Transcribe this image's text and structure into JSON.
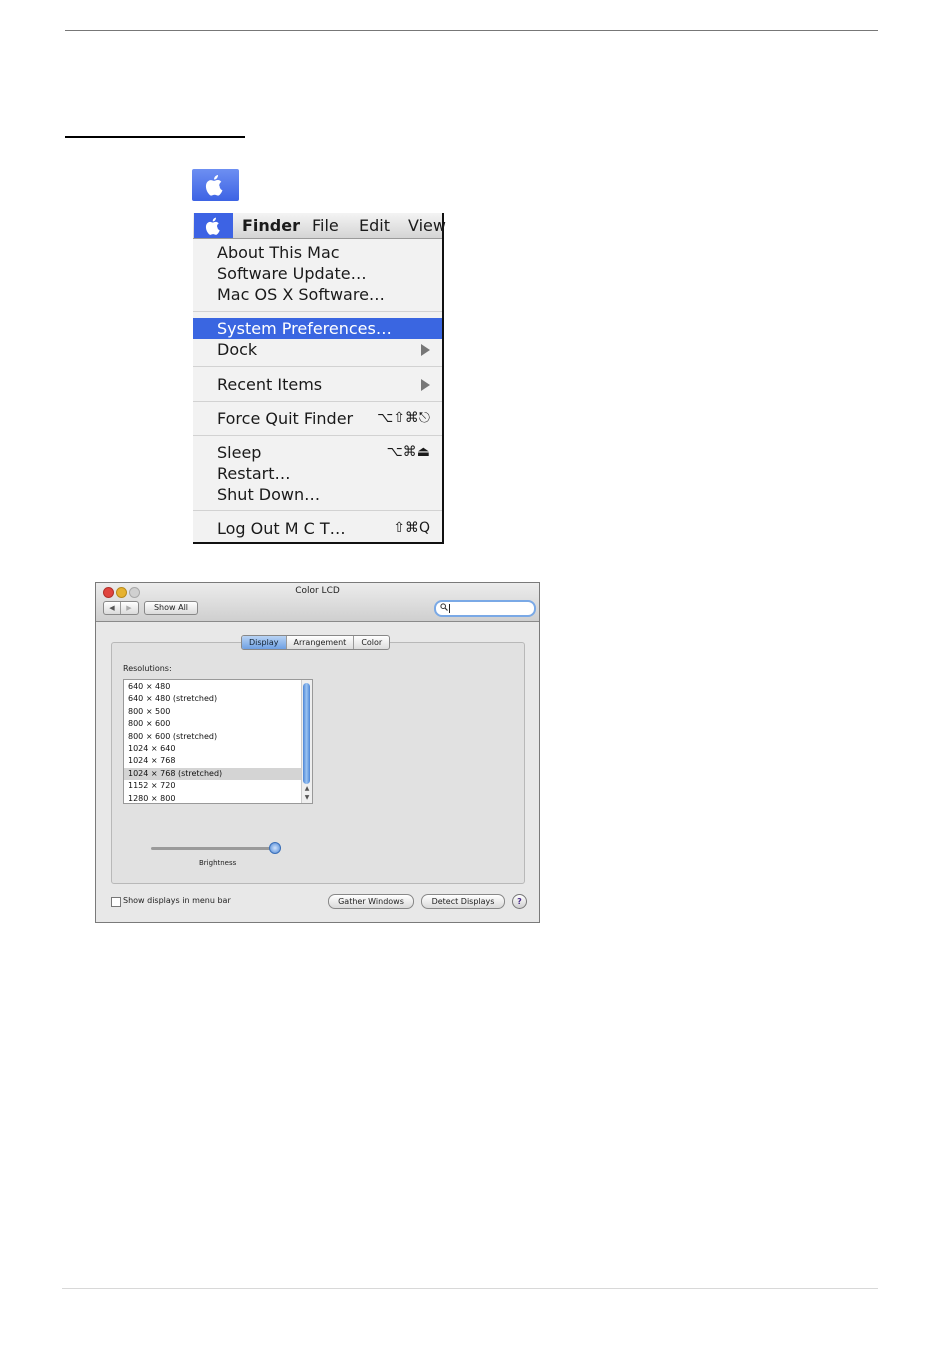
{
  "menu": {
    "menubar": [
      "Finder",
      "File",
      "Edit",
      "View"
    ],
    "items": [
      {
        "label": "About This Mac",
        "shortcut": ""
      },
      {
        "label": "Software Update…",
        "shortcut": ""
      },
      {
        "label": "Mac OS X Software…",
        "shortcut": ""
      },
      {
        "label": "System Preferences…",
        "shortcut": "",
        "highlighted": true
      },
      {
        "label": "Dock",
        "shortcut": "",
        "submenu": true
      },
      {
        "label": "Recent Items",
        "shortcut": "",
        "submenu": true
      },
      {
        "label": "Force Quit Finder",
        "shortcut": "⌥⇧⌘⎋"
      },
      {
        "label": "Sleep",
        "shortcut": "⌥⌘⏏"
      },
      {
        "label": "Restart…",
        "shortcut": ""
      },
      {
        "label": "Shut Down…",
        "shortcut": ""
      },
      {
        "label": "Log Out M C T…",
        "shortcut": "⇧⌘Q"
      }
    ]
  },
  "prefs": {
    "title": "Color LCD",
    "back_glyph": "◀",
    "forward_glyph": "▶",
    "show_all": "Show All",
    "tabs": [
      "Display",
      "Arrangement",
      "Color"
    ],
    "active_tab": "Display",
    "resolutions_label": "Resolutions:",
    "resolutions": [
      "640 × 480",
      "640 × 480 (stretched)",
      "800 × 500",
      "800 × 600",
      "800 × 600 (stretched)",
      "1024 × 640",
      "1024 × 768",
      "1024 × 768 (stretched)",
      "1152 × 720",
      "1280 × 800"
    ],
    "selected_resolution": "1024 × 768 (stretched)",
    "brightness_label": "Brightness",
    "brightness_level": 0.95,
    "show_displays_label": "Show displays in menu bar",
    "show_displays_checked": false,
    "gather_windows": "Gather Windows",
    "detect_displays": "Detect Displays",
    "help": "?"
  },
  "colors": {
    "highlight": "#3a66e1",
    "apple_tile": "#4c6fe8",
    "scroll_thumb": "#4c86d6"
  }
}
